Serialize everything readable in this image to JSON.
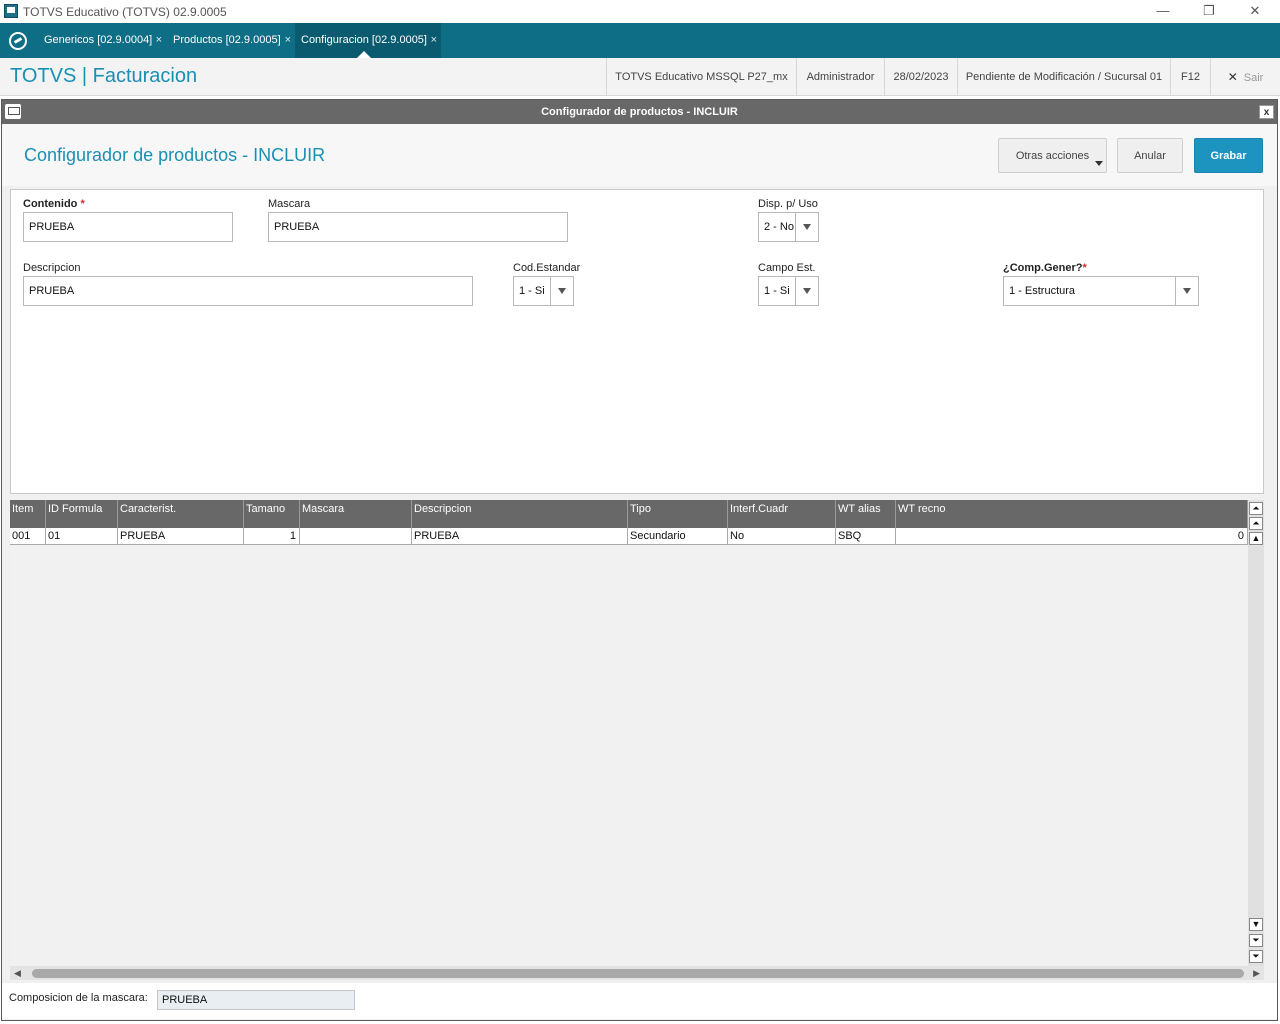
{
  "window": {
    "title": "TOTVS Educativo (TOTVS) 02.9.0005",
    "minimize": "—",
    "restore": "❐",
    "close": "✕"
  },
  "tabs": [
    {
      "label": "Genericos [02.9.0004]",
      "close": "×"
    },
    {
      "label": "Productos [02.9.0005]",
      "close": "×"
    },
    {
      "label": "Configuracion [02.9.0005]",
      "close": "×"
    }
  ],
  "header": {
    "brand": "TOTVS | Facturacion",
    "environment": "TOTVS Educativo MSSQL P27_mx",
    "user": "Administrador",
    "date": "28/02/2023",
    "status": "Pendiente de Modificación / Sucursal 01",
    "hotkey": "F12",
    "exit_label": "Sair",
    "exit_icon": "✕"
  },
  "dialog": {
    "title": "Configurador de productos - INCLUIR",
    "close": "x",
    "page_title": "Configurador de productos - INCLUIR",
    "buttons": {
      "other_actions": "Otras acciones",
      "cancel": "Anular",
      "save": "Grabar"
    }
  },
  "form": {
    "contenido": {
      "label": "Contenido",
      "required": "*",
      "value": "PRUEBA"
    },
    "mascara": {
      "label": "Mascara",
      "value": "PRUEBA"
    },
    "disp_uso": {
      "label": "Disp. p/ Uso",
      "value": "2 - No"
    },
    "descripcion": {
      "label": "Descripcion",
      "value": "PRUEBA"
    },
    "cod_estandar": {
      "label": "Cod.Estandar",
      "value": "1 - Si"
    },
    "campo_est": {
      "label": "Campo Est.",
      "value": "1 - Si"
    },
    "comp_gener": {
      "label": "¿Comp.Gener?",
      "required": "*",
      "value": "1 - Estructura"
    }
  },
  "grid": {
    "columns": [
      "Item",
      "ID Formula",
      "Caracterist.",
      "Tamano",
      "Mascara",
      "Descripcion",
      "Tipo",
      "Interf.Cuadr",
      "WT alias",
      "WT recno"
    ],
    "rows": [
      [
        "001",
        "01",
        "PRUEBA",
        "1",
        "",
        "PRUEBA",
        "Secundario",
        "No",
        "SBQ",
        "0"
      ]
    ],
    "scroll_top": "⏶",
    "scroll_bottom": "⏷",
    "scroll_up": "▲",
    "scroll_down": "▼",
    "scroll_left": "◀",
    "scroll_right": "▶"
  },
  "footer": {
    "label": "Composicion de la mascara:",
    "value": "PRUEBA"
  }
}
